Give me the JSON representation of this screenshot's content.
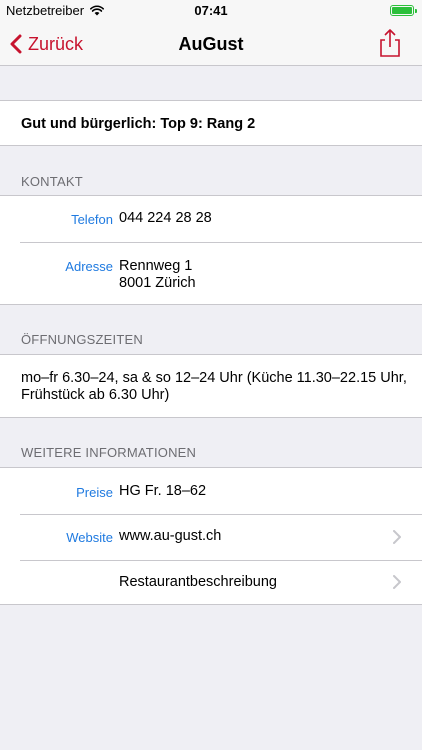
{
  "status_bar": {
    "carrier": "Netzbetreiber",
    "time": "07:41",
    "battery_level": 1.0
  },
  "nav": {
    "back_label": "Zurück",
    "title": "AuGust"
  },
  "ranking": {
    "text": "Gut und bürgerlich: Top 9: Rang 2"
  },
  "kontakt": {
    "header": "KONTAKT",
    "phone_label": "Telefon",
    "phone_value": "044 224 28 28",
    "address_label": "Adresse",
    "address_line1": "Rennweg 1",
    "address_line2": "8001 Zürich"
  },
  "hours": {
    "header": "ÖFFNUNGSZEITEN",
    "line1": "mo–fr 6.30–24, sa & so 12–24 Uhr (Küche 11.30–22.15 Uhr,",
    "line2": "Frühstück ab 6.30 Uhr)"
  },
  "info": {
    "header": "WEITERE INFORMATIONEN",
    "price_label": "Preise",
    "price_value": "HG Fr. 18–62",
    "website_label": "Website",
    "website_value": "www.au-gust.ch",
    "description_value": "Restaurantbeschreibung"
  },
  "colors": {
    "accent": "#c7132e",
    "link_label": "#1f7ae0",
    "background": "#efeff4",
    "battery": "#2bbf3a"
  }
}
